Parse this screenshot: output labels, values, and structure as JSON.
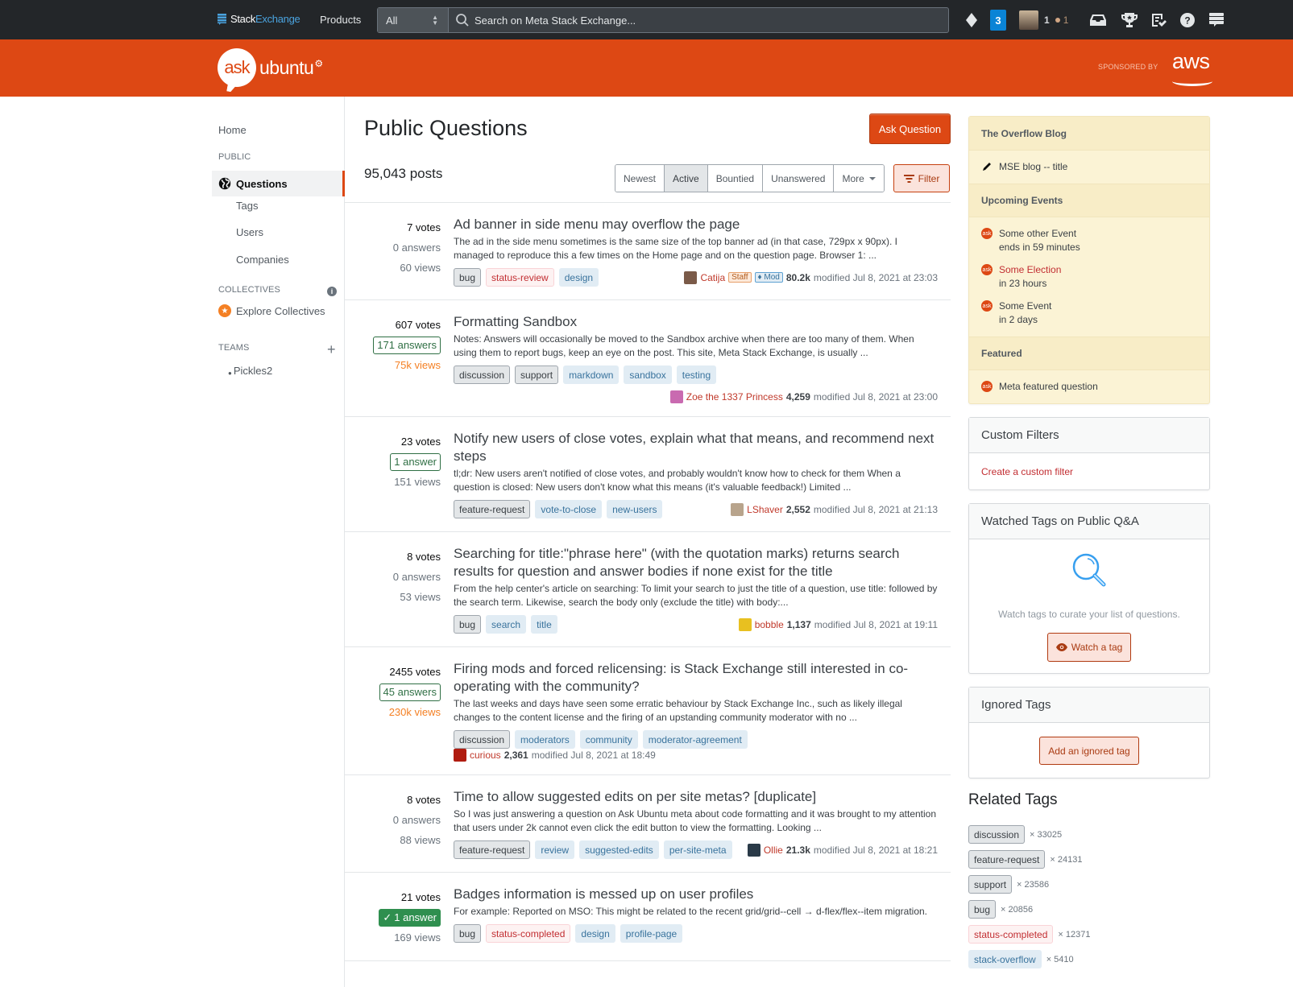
{
  "topbar": {
    "brand_stack": "Stack",
    "brand_exchange": "Exchange",
    "products": "Products",
    "scope": "All",
    "search_placeholder": "Search on Meta Stack Exchange...",
    "inbox_count": "3",
    "reputation": "1",
    "bronze_badges": "1",
    "icons": [
      "diamond-icon",
      "inbox-icon",
      "achievements-icon",
      "review-icon",
      "help-icon",
      "site-switcher-icon"
    ]
  },
  "siteheader": {
    "logo_ask": "ask",
    "logo_ubuntu": "ubuntu",
    "sponsored_by": "SPONSORED BY",
    "sponsor": "aws"
  },
  "leftnav": {
    "home": "Home",
    "public_label": "PUBLIC",
    "questions": "Questions",
    "tags": "Tags",
    "users": "Users",
    "companies": "Companies",
    "collectives_label": "COLLECTIVES",
    "explore_collectives": "Explore Collectives",
    "teams_label": "TEAMS",
    "team_name": "Pickles2"
  },
  "main": {
    "title": "Public Questions",
    "ask_button": "Ask Question",
    "post_count": "95,043 posts",
    "sort_tabs": [
      "Newest",
      "Active",
      "Bountied",
      "Unanswered",
      "More"
    ],
    "active_tab": "Active",
    "filter_button": "Filter",
    "questions": [
      {
        "votes": "7 votes",
        "answers": "0 answers",
        "answers_style": "none",
        "views": "60 views",
        "views_hot": false,
        "title": "Ad banner in side menu may overflow the page",
        "excerpt": "The ad in the side menu sometimes is the same size of the top banner ad (in that case, 729px x 90px). I managed to reproduce this a few times on the Home page and on the question page. Browser 1: ...",
        "tags": [
          {
            "name": "bug",
            "kind": "meta"
          },
          {
            "name": "status-review",
            "kind": "status"
          },
          {
            "name": "design",
            "kind": "normal"
          }
        ],
        "user": "Catija",
        "staff": "Staff",
        "mod": "♦ Mod",
        "rep": "80.2k",
        "modified": "modified Jul 8, 2021 at 23:03",
        "avatar_color": "#7a5a48"
      },
      {
        "votes": "607 votes",
        "answers": "171 answers",
        "answers_style": "boxed",
        "views": "75k views",
        "views_hot": true,
        "title": "Formatting Sandbox",
        "excerpt": "Notes: Answers will occasionally be moved to the Sandbox archive when there are too many of them. When using them to report bugs, keep an eye on the post. This site, Meta Stack Exchange, is usually ...",
        "tags": [
          {
            "name": "discussion",
            "kind": "meta"
          },
          {
            "name": "support",
            "kind": "meta"
          },
          {
            "name": "markdown",
            "kind": "normal"
          },
          {
            "name": "sandbox",
            "kind": "normal"
          },
          {
            "name": "testing",
            "kind": "normal"
          }
        ],
        "user": "Zoe the 1337 Princess",
        "rep": "4,259",
        "modified": "modified Jul 8, 2021 at 23:00",
        "avatar_color": "#c96ab0"
      },
      {
        "votes": "23 votes",
        "answers": "1 answer",
        "answers_style": "boxed",
        "views": "151 views",
        "views_hot": false,
        "title": "Notify new users of close votes, explain what that means, and recommend next steps",
        "excerpt": "tl;dr: New users aren't notified of close votes, and probably wouldn't know how to check for them When a question is closed: New users don't know what this means (it's valuable feedback!) Limited ...",
        "tags": [
          {
            "name": "feature-request",
            "kind": "meta"
          },
          {
            "name": "vote-to-close",
            "kind": "normal"
          },
          {
            "name": "new-users",
            "kind": "normal"
          }
        ],
        "user": "LShaver",
        "rep": "2,552",
        "modified": "modified Jul 8, 2021 at 21:13",
        "avatar_color": "#b8a48c"
      },
      {
        "votes": "8 votes",
        "answers": "0 answers",
        "answers_style": "none",
        "views": "53 views",
        "views_hot": false,
        "title": "Searching for title:\"phrase here\" (with the quotation marks) returns search results for question and answer bodies if none exist for the title",
        "excerpt": "From the help center's article on searching: To limit your search to just the title of a question, use title: followed by the search term. Likewise, search the body only (exclude the title) with body:...",
        "tags": [
          {
            "name": "bug",
            "kind": "meta"
          },
          {
            "name": "search",
            "kind": "normal"
          },
          {
            "name": "title",
            "kind": "normal"
          }
        ],
        "user": "bobble",
        "rep": "1,137",
        "modified": "modified Jul 8, 2021 at 19:11",
        "avatar_color": "#e8c020"
      },
      {
        "votes": "2455 votes",
        "answers": "45 answers",
        "answers_style": "boxed",
        "views": "230k views",
        "views_hot": true,
        "title": "Firing mods and forced relicensing: is Stack Exchange still interested in co-operating with the community?",
        "excerpt": "The last weeks and days have seen some erratic behaviour by Stack Exchange Inc., such as likely illegal changes to the content license and the firing of an upstanding community moderator with no ...",
        "tags": [
          {
            "name": "discussion",
            "kind": "meta"
          },
          {
            "name": "moderators",
            "kind": "normal"
          },
          {
            "name": "community",
            "kind": "normal"
          },
          {
            "name": "moderator-agreement",
            "kind": "normal"
          }
        ],
        "user": "curious",
        "rep": "2,361",
        "modified": "modified Jul 8, 2021 at 18:49",
        "avatar_color": "#b01c10"
      },
      {
        "votes": "8 votes",
        "answers": "0 answers",
        "answers_style": "none",
        "views": "88 views",
        "views_hot": false,
        "title": "Time to allow suggested edits on per site metas? [duplicate]",
        "excerpt": "So I was just answering a question on Ask Ubuntu meta about code formatting and it was brought to my attention that users under 2k cannot even click the edit button to view the formatting. Looking ...",
        "tags": [
          {
            "name": "feature-request",
            "kind": "meta"
          },
          {
            "name": "review",
            "kind": "normal"
          },
          {
            "name": "suggested-edits",
            "kind": "normal"
          },
          {
            "name": "per-site-meta",
            "kind": "normal"
          }
        ],
        "user": "Ollie",
        "rep": "21.3k",
        "modified": "modified Jul 8, 2021 at 18:21",
        "avatar_color": "#2a3a48"
      },
      {
        "votes": "21 votes",
        "answers": "1 answer",
        "answers_style": "accepted",
        "views": "169 views",
        "views_hot": false,
        "title": "Badges information is messed up on user profiles",
        "excerpt": "For example: Reported on MSO: This might be related to the recent grid/grid--cell → d-flex/flex--item migration.",
        "tags": [
          {
            "name": "bug",
            "kind": "meta"
          },
          {
            "name": "status-completed",
            "kind": "status"
          },
          {
            "name": "design",
            "kind": "normal"
          },
          {
            "name": "profile-page",
            "kind": "normal"
          }
        ]
      }
    ]
  },
  "rightside": {
    "blog_header": "The Overflow Blog",
    "blog_item": "MSE blog -- title",
    "events_header": "Upcoming Events",
    "events": [
      {
        "name": "Some other Event",
        "when": "ends in 59 minutes",
        "highlight": false
      },
      {
        "name": "Some Election",
        "when": "in 23 hours",
        "highlight": true
      },
      {
        "name": "Some Event",
        "when": "in 2 days",
        "highlight": false
      }
    ],
    "featured_header": "Featured",
    "featured_item": "Meta featured question",
    "custom_filters_title": "Custom Filters",
    "create_filter": "Create a custom filter",
    "watched_title": "Watched Tags on Public Q&A",
    "watched_text": "Watch tags to curate your list of questions.",
    "watch_button": "Watch a tag",
    "ignored_title": "Ignored Tags",
    "ignored_button": "Add an ignored tag",
    "related_title": "Related Tags",
    "related_tags": [
      {
        "name": "discussion",
        "kind": "meta",
        "count": "× 33025"
      },
      {
        "name": "feature-request",
        "kind": "meta",
        "count": "× 24131"
      },
      {
        "name": "support",
        "kind": "meta",
        "count": "× 23586"
      },
      {
        "name": "bug",
        "kind": "meta",
        "count": "× 20856"
      },
      {
        "name": "status-completed",
        "kind": "status",
        "count": "× 12371"
      },
      {
        "name": "stack-overflow",
        "kind": "normal",
        "count": "× 5410"
      }
    ]
  },
  "colors": {
    "brand_orange": "#dd4814",
    "topbar": "#232629",
    "accepted_green": "#2f8f4f",
    "link_red": "#c22e32"
  }
}
